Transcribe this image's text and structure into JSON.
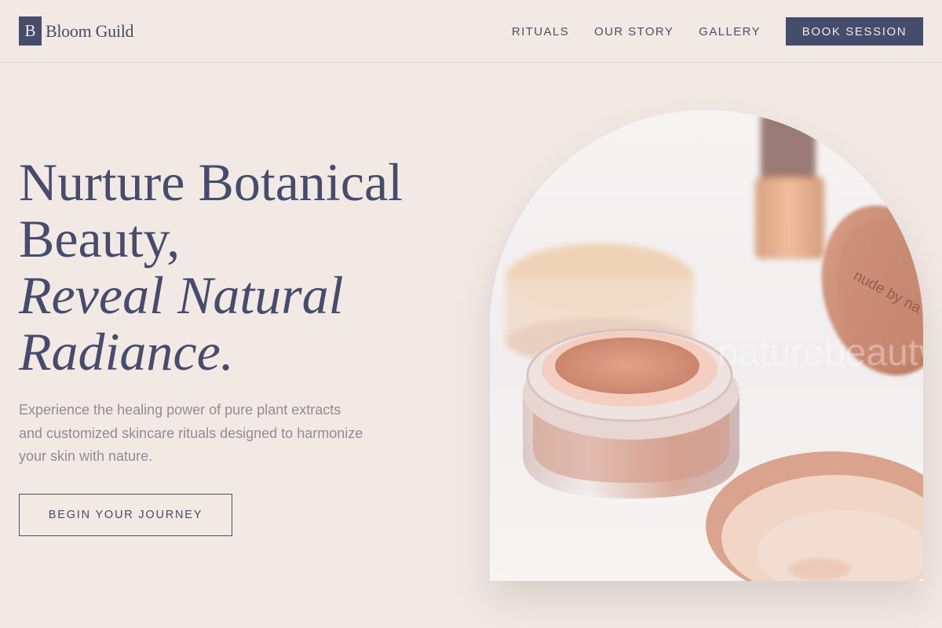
{
  "brand": {
    "mark": "B",
    "name": "Bloom Guild"
  },
  "nav": {
    "items": [
      {
        "label": "RITUALS"
      },
      {
        "label": "OUR STORY"
      },
      {
        "label": "GALLERY"
      }
    ],
    "cta": "BOOK SESSION"
  },
  "hero": {
    "title_line1": "Nurture Botanical",
    "title_line2": "Beauty,",
    "title_line3": "Reveal Natural",
    "title_line4": "Radiance.",
    "description": "Experience the healing power of pure plant extracts and customized skincare rituals designed to harmonize your skin with nature.",
    "cta": "BEGIN YOUR JOURNEY"
  },
  "image": {
    "jar_lid_text": "nude by na",
    "watermark": "naturebeauty"
  },
  "colors": {
    "background": "#f2e9e5",
    "primary": "#464c6b",
    "muted_text": "#948b92"
  }
}
